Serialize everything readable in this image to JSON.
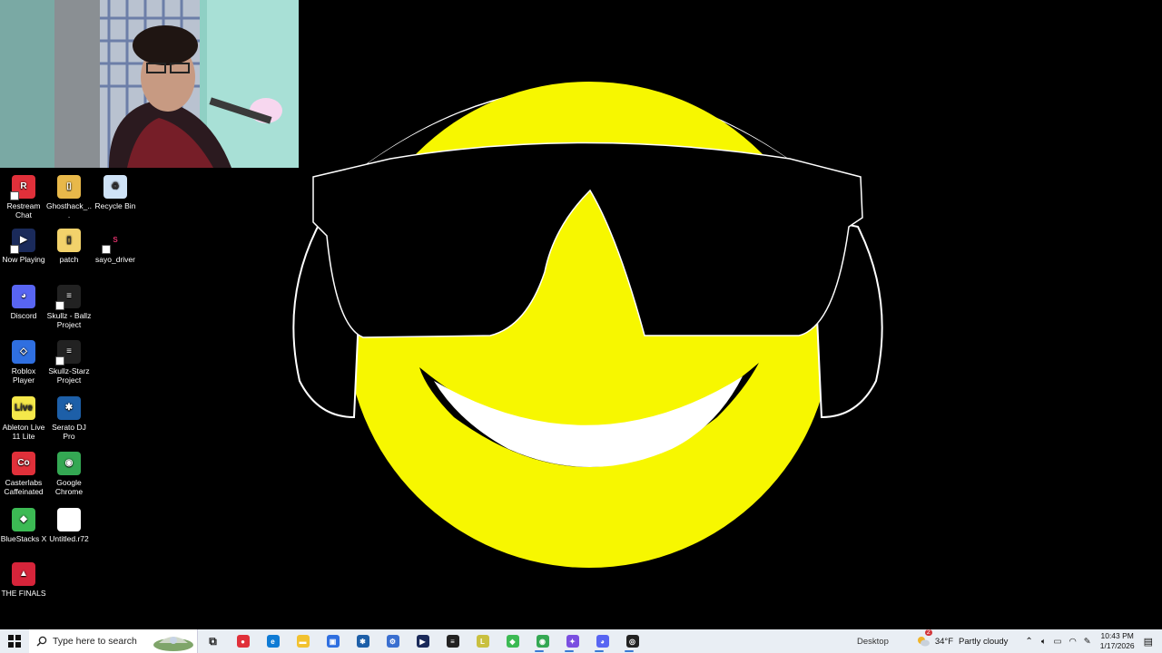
{
  "desktop": {
    "icons": [
      {
        "label": "Restream Chat",
        "icon": "restream-icon",
        "color": "#e0303a"
      },
      {
        "label": "Ghosthack_...",
        "icon": "zip-folder-icon",
        "color": "#e8b84a"
      },
      {
        "label": "Recycle Bin",
        "icon": "recycle-bin-icon",
        "color": "#cfe3f7"
      },
      {
        "label": "Now Playing",
        "icon": "now-playing-icon",
        "color": "#1a2a5a"
      },
      {
        "label": "patch",
        "icon": "folder-icon",
        "color": "#f2d26b"
      },
      {
        "label": "sayo_driver",
        "icon": "sayo-icon",
        "color": "#000000"
      },
      {
        "label": "Discord",
        "icon": "discord-icon",
        "color": "#5865f2"
      },
      {
        "label": "Skullz - Ballz Project",
        "icon": "ableton-project-icon",
        "color": "#222222"
      },
      {
        "label": "Roblox Player",
        "icon": "roblox-icon",
        "color": "#2f6fe0"
      },
      {
        "label": "Skullz-Starz Project",
        "icon": "ableton-project-icon",
        "color": "#222222"
      },
      {
        "label": "Ableton Live 11 Lite",
        "icon": "ableton-icon",
        "color": "#f5e84a"
      },
      {
        "label": "Serato DJ Pro",
        "icon": "serato-icon",
        "color": "#1d5fa8"
      },
      {
        "label": "Casterlabs Caffeinated",
        "icon": "casterlabs-icon",
        "color": "#e0303a"
      },
      {
        "label": "Google Chrome",
        "icon": "chrome-icon",
        "color": "#34a853"
      },
      {
        "label": "BlueStacks X",
        "icon": "bluestacks-icon",
        "color": "#3cba54"
      },
      {
        "label": "Untitled.r72",
        "icon": "file-icon",
        "color": "#ffffff"
      },
      {
        "label": "THE FINALS",
        "icon": "the-finals-icon",
        "color": "#d6243a"
      }
    ],
    "wallpaper": {
      "face_color": "#f7f700",
      "background": "#000000"
    }
  },
  "webcam": {
    "description_color": "#5aa0a0"
  },
  "taskbar": {
    "search_placeholder": "Type here to search",
    "desktop_label": "Desktop",
    "weather_temp": "34°F",
    "weather_text": "Partly cloudy",
    "weather_badge": "2",
    "time": "10:43 PM",
    "date": "1/17/2026",
    "accent": "#3a7bd5",
    "apps": [
      {
        "name": "task-view-icon",
        "glyph": "⧉",
        "color": "#333333"
      },
      {
        "name": "restream-taskbar-icon",
        "glyph": "●",
        "color": "#e0303a"
      },
      {
        "name": "edge-icon",
        "glyph": "e",
        "color": "#0f7bd5"
      },
      {
        "name": "file-explorer-icon",
        "glyph": "▬",
        "color": "#f2c230"
      },
      {
        "name": "store-icon",
        "glyph": "▣",
        "color": "#2f6fe0"
      },
      {
        "name": "serato-taskbar-icon",
        "glyph": "✱",
        "color": "#1d5fa8"
      },
      {
        "name": "control-panel-icon",
        "glyph": "⚙",
        "color": "#3a6fd0"
      },
      {
        "name": "now-playing-taskbar-icon",
        "glyph": "▶",
        "color": "#1a2a5a"
      },
      {
        "name": "live-project-icon",
        "glyph": "≡",
        "color": "#222222"
      },
      {
        "name": "ableton-taskbar-icon",
        "glyph": "L",
        "color": "#c9c040"
      },
      {
        "name": "bluestacks-taskbar-icon",
        "glyph": "◆",
        "color": "#3cba54"
      },
      {
        "name": "chrome-taskbar-icon",
        "glyph": "◉",
        "color": "#34a853"
      },
      {
        "name": "copilot-icon",
        "glyph": "✦",
        "color": "#7a4fe0"
      },
      {
        "name": "discord-taskbar-icon",
        "glyph": "◕",
        "color": "#5865f2"
      },
      {
        "name": "obs-icon",
        "glyph": "◎",
        "color": "#222222"
      }
    ]
  }
}
